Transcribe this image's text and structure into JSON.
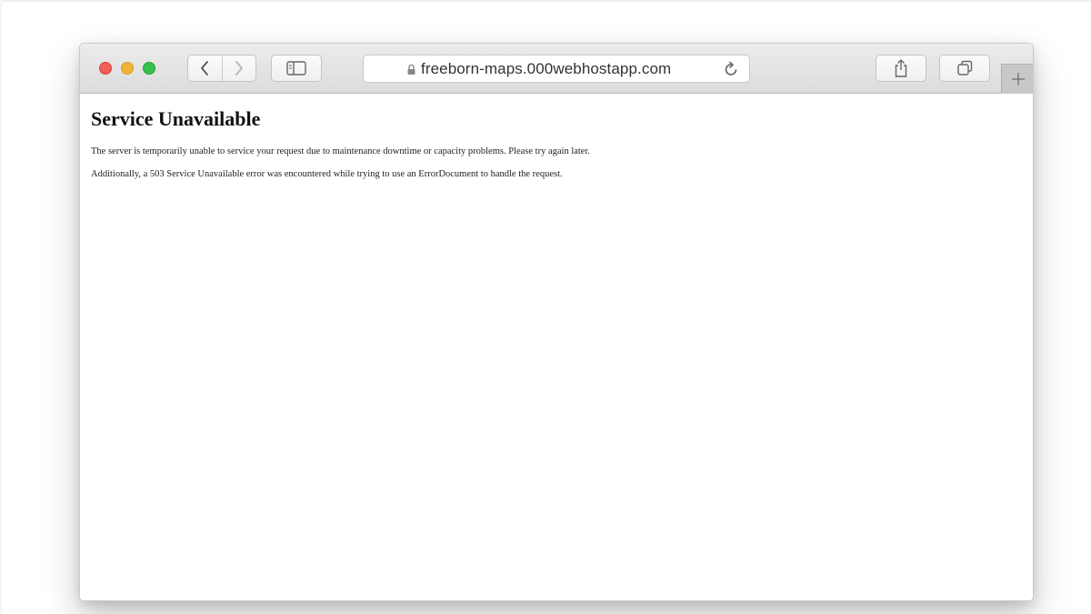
{
  "browser": {
    "url": "freeborn-maps.000webhostapp.com",
    "icons": {
      "close": "red-traffic-light",
      "minimize": "yellow-traffic-light",
      "zoom": "green-traffic-light",
      "back": "chevron-left-icon",
      "forward": "chevron-right-icon",
      "sidebar": "sidebar-icon",
      "lock": "lock-icon",
      "reload": "reload-icon",
      "share": "share-icon",
      "tabs": "tabs-overview-icon",
      "new_tab": "plus-icon"
    },
    "colors": {
      "close": "#ed5f57",
      "minimize": "#f2b436",
      "zoom": "#36c14a"
    }
  },
  "page": {
    "title": "Service Unavailable",
    "paragraphs": [
      "The server is temporarily unable to service your request due to maintenance downtime or capacity problems. Please try again later.",
      "Additionally, a 503 Service Unavailable error was encountered while trying to use an ErrorDocument to handle the request."
    ]
  }
}
